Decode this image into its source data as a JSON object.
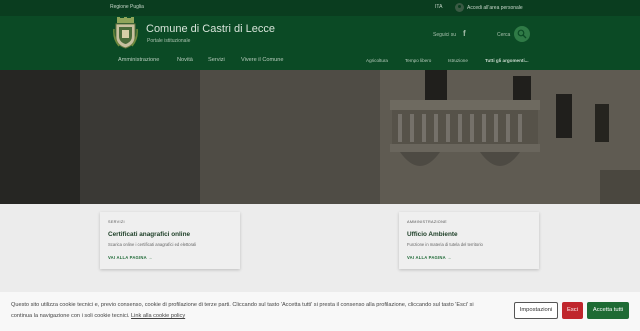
{
  "slim_header": {
    "region": "Regione Puglia",
    "language": "ITA",
    "login_label": "Accedi all'area personale"
  },
  "header": {
    "title": "Comune di Castri di Lecce",
    "subtitle": "Portale istituzionale",
    "follow_label": "Seguici su",
    "search_label": "Cerca"
  },
  "nav": {
    "main": [
      "Amministrazione",
      "Novità",
      "Servizi",
      "Vivere il Comune"
    ],
    "secondary": [
      "Agricoltura",
      "Tempo libero",
      "Istruzione"
    ],
    "all_topics": "Tutti gli argomenti..."
  },
  "cards": [
    {
      "category": "SERVIZI",
      "title": "Certificati anagrafici online",
      "description": "Scarica online i certificati anagrafici ed elettorali",
      "link": "VAI ALLA PAGINA"
    },
    {
      "category": "AMMINISTRAZIONE",
      "title": "Ufficio Ambiente",
      "description": "Funzione in materia di tutela del territorio",
      "link": "VAI ALLA PAGINA"
    }
  ],
  "cookie": {
    "line1": "Questo sito utilizza cookie tecnici e, previo consenso, cookie di profilazione di terze parti. Cliccando sul tasto 'Accetta tutti' si presta il consenso alla profilazione, cliccando sul tasto 'Esci' si",
    "line2_text": "continua la navigazione con i soli cookie tecnici. ",
    "line2_link": "Link alla cookie policy",
    "settings_label": "Impostazioni",
    "exit_label": "Esci",
    "accept_label": "Accetta tutti"
  },
  "colors": {
    "header_green": "#0b4a25",
    "accent_green": "#1e6b34",
    "exit_red": "#c0262c"
  }
}
